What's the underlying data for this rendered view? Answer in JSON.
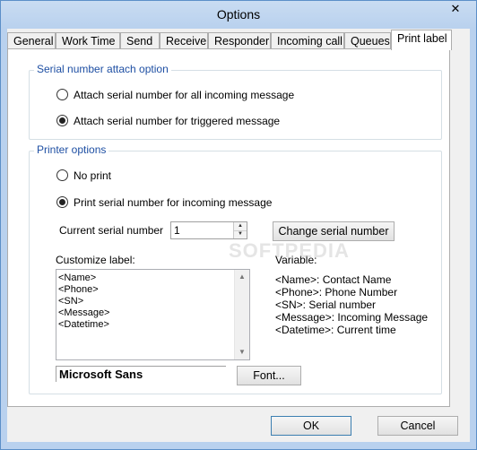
{
  "window": {
    "title": "Options",
    "close_glyph": "✕"
  },
  "tabs": [
    {
      "label": "General"
    },
    {
      "label": "Work Time"
    },
    {
      "label": "Send"
    },
    {
      "label": "Receive"
    },
    {
      "label": "Responder"
    },
    {
      "label": "Incoming call"
    },
    {
      "label": "Queues"
    },
    {
      "label": "Print label",
      "active": true
    }
  ],
  "serial_group": {
    "legend": "Serial number attach option",
    "options": [
      {
        "label": "Attach serial number for all incoming message",
        "checked": false
      },
      {
        "label": "Attach serial number for triggered message",
        "checked": true
      }
    ]
  },
  "printer_group": {
    "legend": "Printer options",
    "options": [
      {
        "label": "No print",
        "checked": false
      },
      {
        "label": "Print serial number for incoming message",
        "checked": true
      }
    ],
    "current_serial_label": "Current serial number",
    "current_serial_value": "1",
    "change_serial_button": "Change serial number",
    "customize_label": "Customize label:",
    "label_lines": [
      "<Name>",
      "<Phone>",
      "<SN>",
      "<Message>",
      "<Datetime>"
    ],
    "variable_title": "Variable:",
    "variables": [
      "<Name>: Contact Name",
      "<Phone>: Phone Number",
      "<SN>: Serial number",
      "<Message>: Incoming Message",
      "<Datetime>: Current time"
    ],
    "font_preview": "Microsoft Sans",
    "font_button": "Font..."
  },
  "footer": {
    "ok": "OK",
    "cancel": "Cancel"
  },
  "watermark": "SOFTPEDIA",
  "colors": {
    "legend": "#1e4fa3",
    "title_bar": "#b9d1ee"
  }
}
